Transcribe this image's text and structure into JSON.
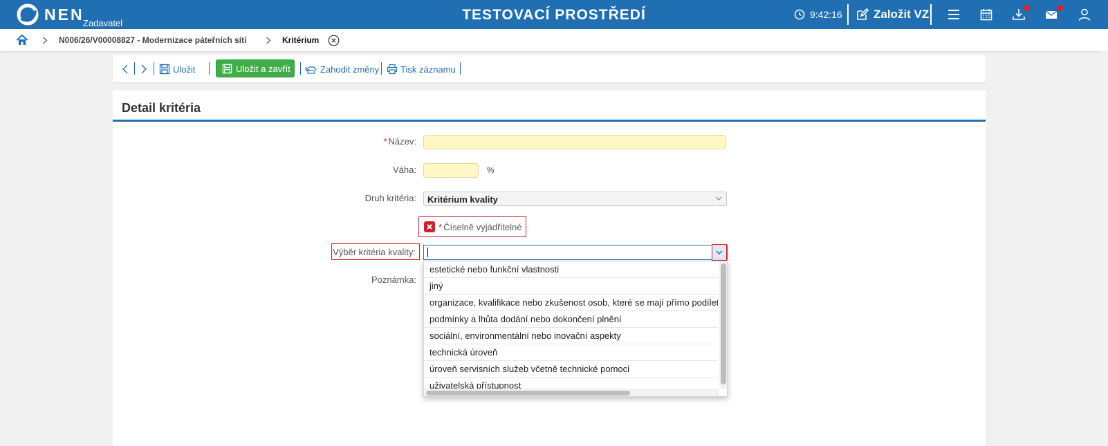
{
  "header": {
    "logo_text": "NEN",
    "logo_sub": "Zadavatel",
    "env_title": "TESTOVACÍ PROSTŘEDÍ",
    "clock": "9:42:16",
    "create_label": "Založit VZ",
    "brand_color": "#1f6fb2",
    "notification_color": "#e0202e",
    "icons": [
      "clock-icon",
      "edit-icon",
      "menu-icon",
      "calendar-icon",
      "download-icon",
      "mail-icon",
      "user-icon"
    ]
  },
  "breadcrumb": {
    "items": [
      "N006/26/V00008827 - Modernizace páteřních sítí",
      "Kritérium"
    ]
  },
  "toolbar": {
    "save_label": "Uložit",
    "save_close_label": "Uložit a zavřít",
    "discard_label": "Zahodit změny",
    "print_label": "Tisk záznamu",
    "save_close_color": "#3fae49"
  },
  "form": {
    "title": "Detail kritéria",
    "name_label": "Název:",
    "name_value": "",
    "weight_label": "Váha:",
    "weight_value": "",
    "weight_unit": "%",
    "type_label": "Druh kritéria:",
    "type_value": "Kritérium kvality",
    "numeric_label": "Číselně vyjádřitelné",
    "quality_label": "Výběr kritéria kvality:",
    "quality_value": "",
    "note_label": "Poznámka:",
    "required_mark": "*",
    "error_color": "#d0202e"
  },
  "dropdown": {
    "options": [
      "estetické nebo funkční vlastnosti",
      "jiný",
      "organizace, kvalifikace nebo zkušenost osob, které se mají přímo podílet",
      "podmínky a lhůta dodání nebo dokončení plnění",
      "sociální, environmentální nebo inovační aspekty",
      "technická úroveň",
      "úroveň servisních služeb včetně technické pomoci",
      "uživatelská přístupnost"
    ]
  }
}
